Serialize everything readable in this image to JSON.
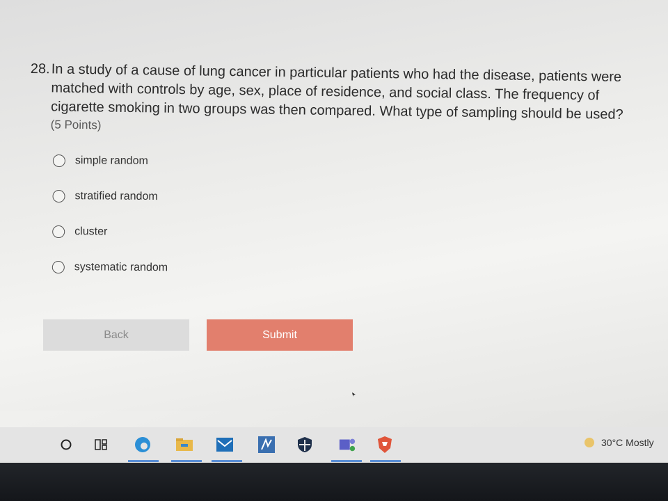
{
  "question": {
    "number": "28.",
    "text": "In a study of a cause of lung cancer in particular patients who had the disease, patients were matched with controls by age, sex, place of residence, and social class. The frequency of cigarette smoking in two groups was then compared. What type of sampling should be used?",
    "points": "(5 Points)"
  },
  "options": [
    {
      "label": "simple random"
    },
    {
      "label": "stratified random"
    },
    {
      "label": "cluster"
    },
    {
      "label": "systematic random"
    }
  ],
  "buttons": {
    "back": "Back",
    "submit": "Submit",
    "submit_color": "#e27f6d"
  },
  "taskbar": {
    "icons": [
      "search-icon",
      "task-view-icon",
      "edge-icon",
      "file-explorer-icon",
      "mail-icon",
      "app-icon",
      "security-icon",
      "teams-icon",
      "brave-icon"
    ],
    "weather": "30°C  Mostly"
  }
}
